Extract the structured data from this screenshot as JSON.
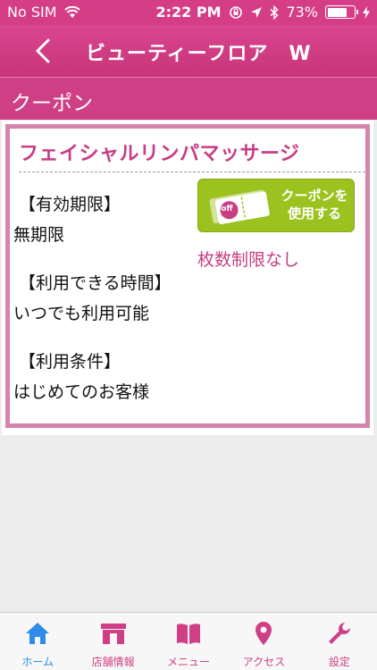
{
  "status": {
    "carrier": "No SIM",
    "time": "2:22 PM",
    "battery": "73%",
    "battery_level": 0.73
  },
  "header": {
    "title": "ビューティーフロア　W"
  },
  "section": {
    "title": "クーポン"
  },
  "coupon": {
    "name": "フェイシャルリンパマッサージ",
    "fields": [
      {
        "label": "【有効期限】",
        "value": "無期限"
      },
      {
        "label": "【利用できる時間】",
        "value": "いつでも利用可能"
      },
      {
        "label": "【利用条件】",
        "value": "はじめてのお客様"
      }
    ],
    "use_button": {
      "line1": "クーポンを",
      "line2": "使用する",
      "badge": "off"
    },
    "limit_text": "枚数制限なし"
  },
  "tabs": [
    {
      "label": "ホーム",
      "icon": "home-icon",
      "active": true
    },
    {
      "label": "店舗情報",
      "icon": "shop-icon",
      "active": false
    },
    {
      "label": "メニュー",
      "icon": "book-icon",
      "active": false
    },
    {
      "label": "アクセス",
      "icon": "map-pin-icon",
      "active": false
    },
    {
      "label": "設定",
      "icon": "wrench-icon",
      "active": false
    }
  ],
  "colors": {
    "brand": "#cf3f85",
    "active_tab": "#2e8be8",
    "button": "#9cc21f"
  }
}
